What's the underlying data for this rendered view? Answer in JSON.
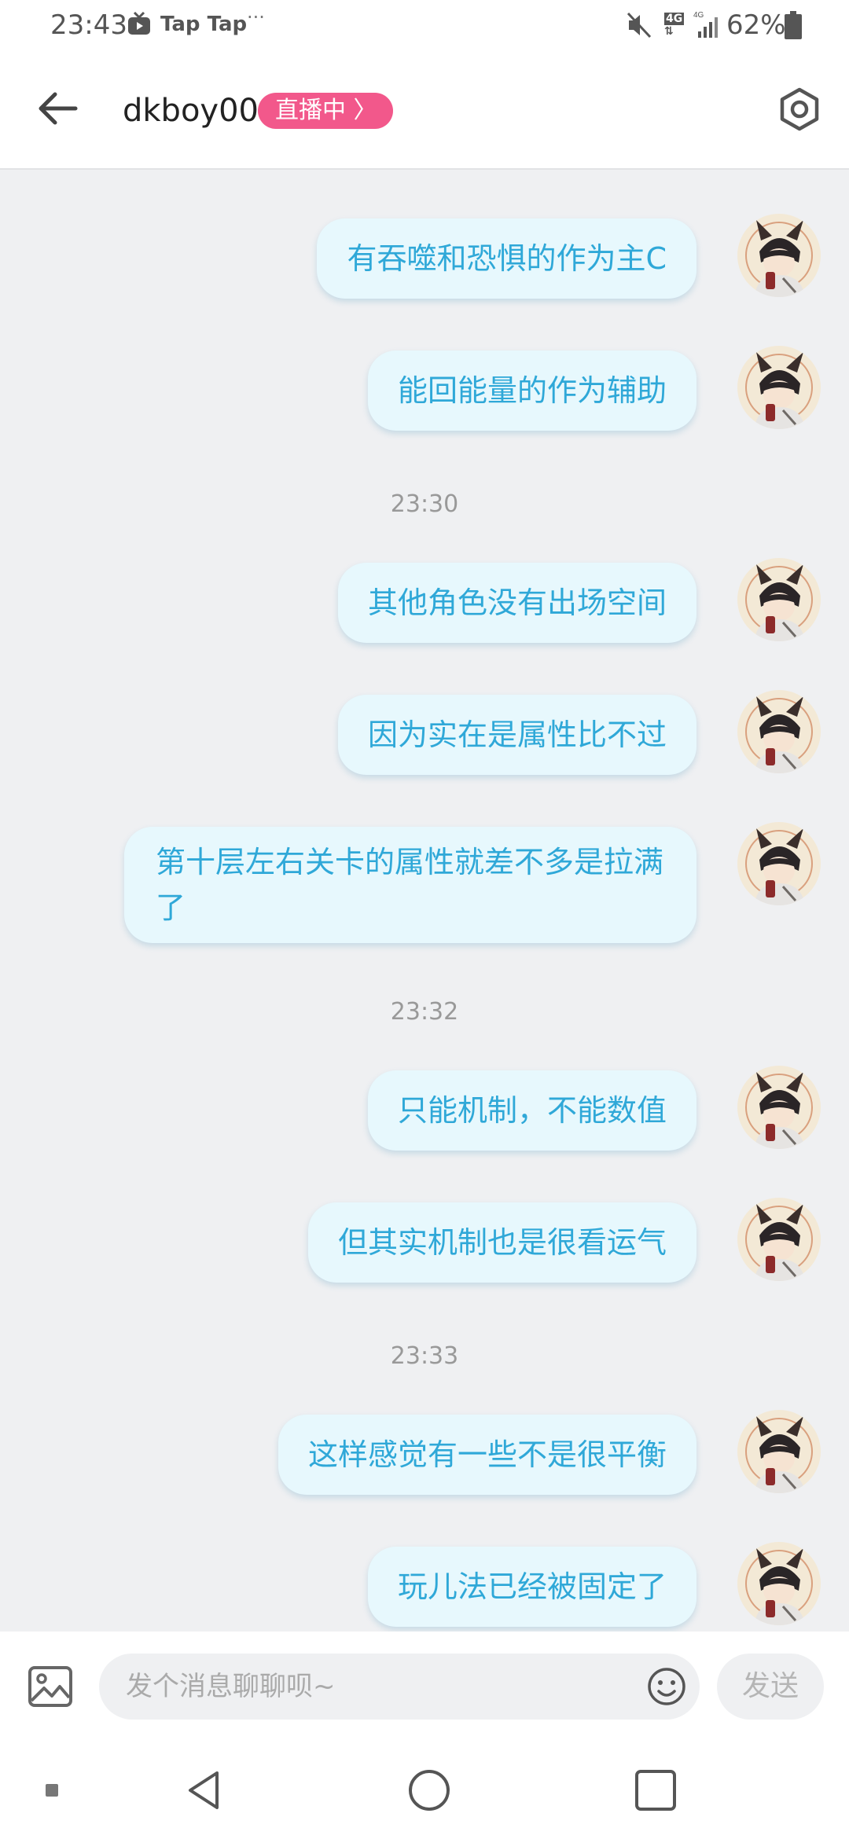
{
  "status_bar": {
    "time": "23:43",
    "app_name": "Tap Tap",
    "more": "···",
    "network_type": "4G",
    "network_type_2": "4G",
    "battery": "62%"
  },
  "header": {
    "title": "dkboy00",
    "live_badge": "直播中 〉"
  },
  "messages": [
    {
      "type": "message",
      "text": "有吞噬和恐惧的作为主C"
    },
    {
      "type": "message",
      "text": "能回能量的作为辅助"
    },
    {
      "type": "timestamp",
      "text": "23:30"
    },
    {
      "type": "message",
      "text": "其他角色没有出场空间"
    },
    {
      "type": "message",
      "text": "因为实在是属性比不过"
    },
    {
      "type": "message",
      "text": "第十层左右关卡的属性就差不多是拉满了"
    },
    {
      "type": "timestamp",
      "text": "23:32"
    },
    {
      "type": "message",
      "text": "只能机制，不能数值"
    },
    {
      "type": "message",
      "text": "但其实机制也是很看运气"
    },
    {
      "type": "timestamp",
      "text": "23:33"
    },
    {
      "type": "message",
      "text": "这样感觉有一些不是很平衡"
    },
    {
      "type": "message",
      "text": "玩儿法已经被固定了"
    }
  ],
  "input_bar": {
    "placeholder": "发个消息聊聊呗~",
    "value": "",
    "send_label": "发送"
  },
  "colors": {
    "bubble_bg": "#e7f8fd",
    "bubble_text": "#2fa8d8",
    "live_badge": "#f2588b",
    "background": "#eff0f2"
  }
}
